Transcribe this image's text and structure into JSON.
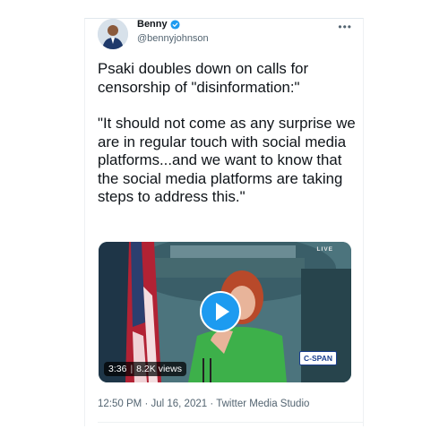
{
  "author": {
    "name": "Benny",
    "handle": "@bennyjohnson",
    "verified": true
  },
  "tweet": {
    "paragraphs": [
      "Psaki doubles down on calls for censorship of \"disinformation:\"",
      "\"It should not come as any surprise we are in regular touch with social media platforms...and we want to know that the social media platforms are taking steps to address this.\""
    ]
  },
  "media": {
    "live_label": "LIVE",
    "duration": "3:36",
    "views": "8.2K views",
    "broadcaster_logo": "C-SPAN",
    "play_icon": "play-icon"
  },
  "meta": {
    "time": "12:50 PM",
    "date": "Jul 16, 2021",
    "source": "Twitter Media Studio",
    "separator": "·"
  },
  "colors": {
    "accent": "#1d9bf0",
    "text": "#0f1419",
    "secondary": "#536471"
  }
}
